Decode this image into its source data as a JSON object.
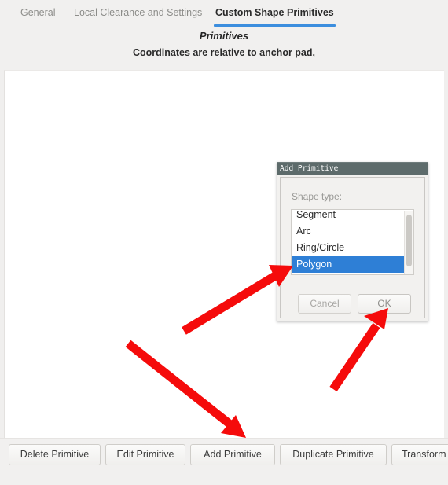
{
  "window": {
    "background_color": "#f1f0ef"
  },
  "tabs": [
    {
      "id": "general",
      "label": "General",
      "active": false
    },
    {
      "id": "local",
      "label": "Local Clearance and Settings",
      "active": false
    },
    {
      "id": "custom",
      "label": "Custom Shape Primitives",
      "active": true
    }
  ],
  "panel": {
    "heading": "Primitives",
    "note": "Coordinates are relative to anchor pad,"
  },
  "toolbar": {
    "delete_label": "Delete Primitive",
    "edit_label": "Edit Primitive",
    "add_label": "Add Primitive",
    "duplicate_label": "Duplicate Primitive",
    "transform_label": "Transform"
  },
  "dialog": {
    "title": "Add Primitive",
    "shape_type_label": "Shape type:",
    "list_items": [
      {
        "label": "Segment",
        "selected": false,
        "clipped": true
      },
      {
        "label": "Arc",
        "selected": false,
        "clipped": false
      },
      {
        "label": "Ring/Circle",
        "selected": false,
        "clipped": false
      },
      {
        "label": "Polygon",
        "selected": true,
        "clipped": false
      }
    ],
    "selected_value": "Polygon",
    "cancel_label": "Cancel",
    "ok_label": "OK",
    "titlebar_color": "#5d6b6b",
    "selection_color": "#2e7fd6"
  },
  "annotations": {
    "arrow_color": "#f50b0b",
    "arrows": [
      {
        "name": "arrow-to-polygon-item",
        "target": "Polygon list item"
      },
      {
        "name": "arrow-to-ok-button",
        "target": "OK"
      },
      {
        "name": "arrow-to-add-primitive-button",
        "target": "Add Primitive"
      }
    ]
  },
  "theme": {
    "accent_color": "#3c8ede",
    "panel_background": "#ffffff",
    "chrome_background": "#f1f0ef"
  }
}
